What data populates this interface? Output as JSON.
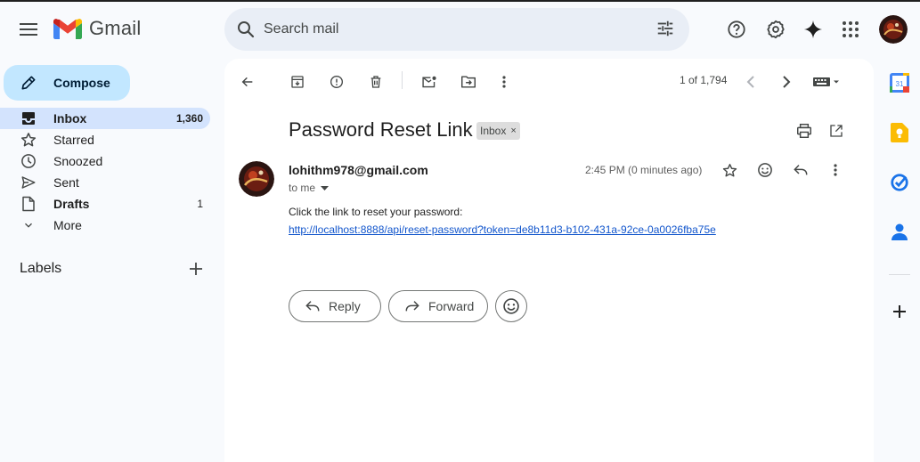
{
  "app": {
    "name": "Gmail"
  },
  "search": {
    "placeholder": "Search mail"
  },
  "sidebar": {
    "compose_label": "Compose",
    "items": [
      {
        "label": "Inbox",
        "count": "1,360"
      },
      {
        "label": "Starred",
        "count": ""
      },
      {
        "label": "Snoozed",
        "count": ""
      },
      {
        "label": "Sent",
        "count": ""
      },
      {
        "label": "Drafts",
        "count": "1"
      },
      {
        "label": "More",
        "count": ""
      }
    ],
    "labels_heading": "Labels"
  },
  "toolbar": {
    "pager": "1 of 1,794"
  },
  "email": {
    "subject": "Password Reset Link",
    "chip": "Inbox",
    "chip_close": "×",
    "sender": "lohithm978@gmail.com",
    "to": "to me",
    "time": "2:45 PM (0 minutes ago)",
    "body": "Click the link to reset your password:",
    "link": "http://localhost:8888/api/reset-password?token=de8b11d3-b102-431a-92ce-0a0026fba75e"
  },
  "actions": {
    "reply": "Reply",
    "forward": "Forward"
  },
  "rail": {
    "calendar_day": "31"
  },
  "colors": {
    "accent": "#c2e7ff",
    "active_nav": "#d3e3fd",
    "search_bg": "#e9eef6",
    "link": "#1155cc"
  },
  "icons": [
    "menu-icon",
    "gmail-logo",
    "search-icon",
    "tune-icon",
    "help-icon",
    "settings-icon",
    "gemini-icon",
    "apps-icon",
    "pencil-icon",
    "inbox-icon",
    "star-icon",
    "clock-icon",
    "send-icon",
    "draft-icon",
    "chevron-down-icon",
    "plus-icon",
    "back-arrow-icon",
    "archive-icon",
    "report-icon",
    "delete-icon",
    "mark-unread-icon",
    "move-to-icon",
    "more-vert-icon",
    "chevron-left-icon",
    "chevron-right-icon",
    "keyboard-icon",
    "print-icon",
    "open-new-window-icon",
    "emoji-icon",
    "reply-icon",
    "forward-icon",
    "calendar-icon",
    "keep-icon",
    "tasks-icon",
    "contacts-icon"
  ]
}
